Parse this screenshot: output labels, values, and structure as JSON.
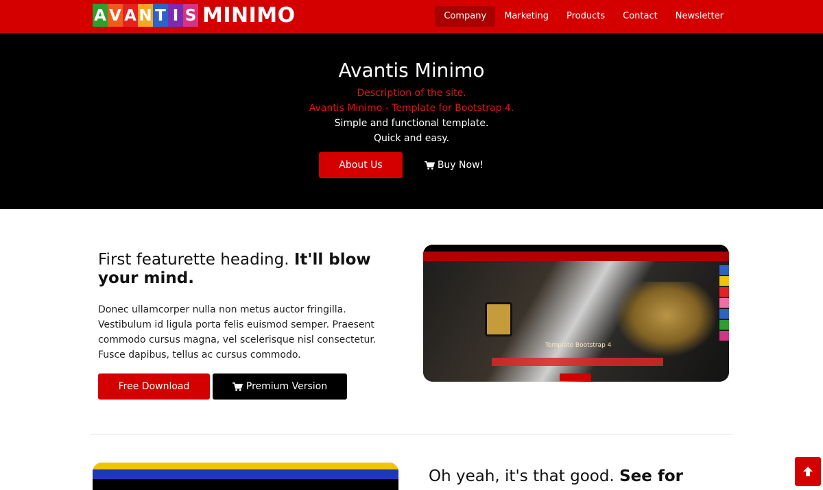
{
  "brand": {
    "letters": [
      "A",
      "V",
      "A",
      "N",
      "T",
      "I",
      "S"
    ],
    "tile_colors": [
      "#2e9e2e",
      "#f05a1a",
      "#e52222",
      "#f5a623",
      "#2d63c8",
      "#7b2bb0",
      "#d63384"
    ],
    "word": "MINIMO"
  },
  "nav": {
    "items": [
      {
        "label": "Company",
        "active": true
      },
      {
        "label": "Marketing",
        "active": false
      },
      {
        "label": "Products",
        "active": false
      },
      {
        "label": "Contact",
        "active": false
      },
      {
        "label": "Newsletter",
        "active": false
      }
    ]
  },
  "hero": {
    "title": "Avantis Minimo",
    "line1": "Description of the site.",
    "line2": "Avantis Minimo - Template for Bootstrap 4.",
    "line3": "Simple and functional template.",
    "line4": "Quick and easy.",
    "about_label": "About Us",
    "buy_label": "Buy Now!",
    "buy_icon": "cart-icon"
  },
  "featurette1": {
    "heading_normal": "First featurette heading.",
    "heading_bold": "It'll blow your mind.",
    "text": "Donec ullamcorper nulla non metus auctor fringilla. Vestibulum id ligula porta felis euismod semper. Praesent commodo cursus magna, vel scelerisque nisl consectetur. Fusce dapibus, tellus ac cursus commodo.",
    "free_label": "Free Download",
    "premium_label": "Premium Version",
    "premium_icon": "cart-icon",
    "image_caption": "Template Bootstrap 4"
  },
  "featurette2": {
    "heading_normal": "Oh yeah, it's that good.",
    "heading_bold": "See for"
  },
  "back_to_top_icon": "arrow-up-icon",
  "colors": {
    "primary": "#d40000",
    "hero_bg": "#000000",
    "hero_accent": "#e41313"
  }
}
